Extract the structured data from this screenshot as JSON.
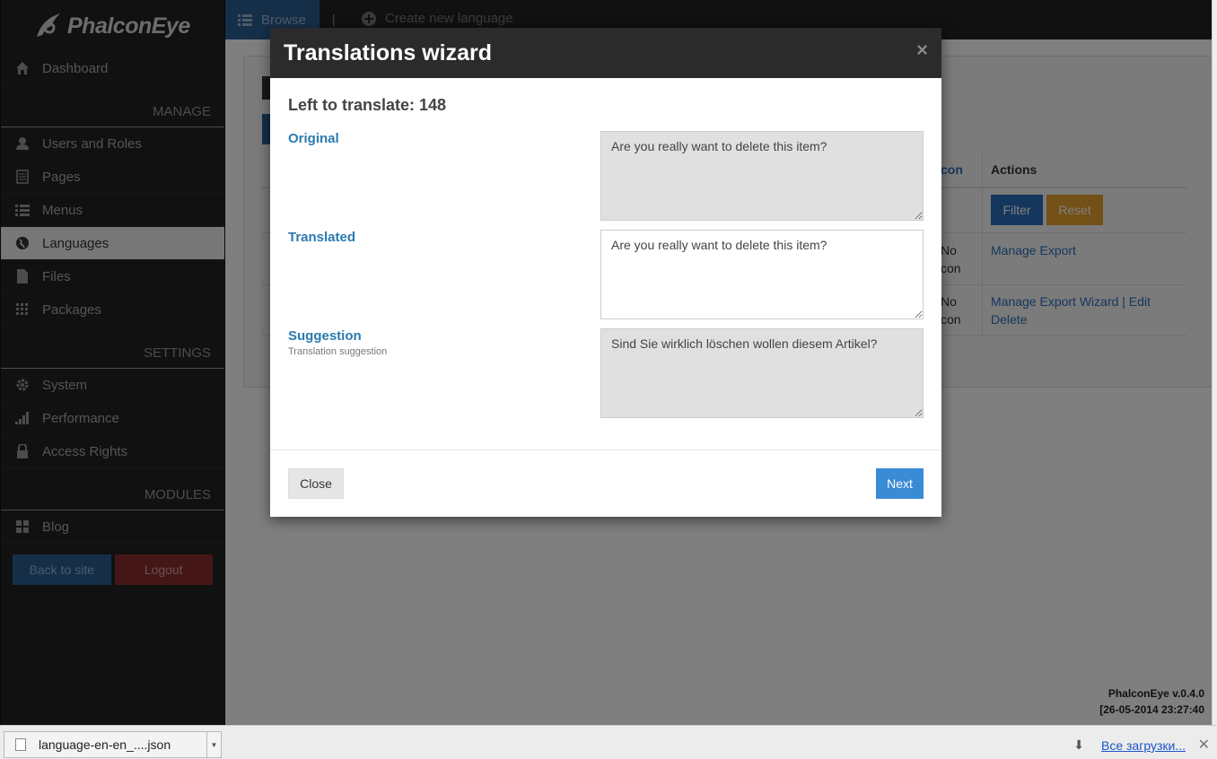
{
  "sidebar": {
    "logo_text": "PhalconEye",
    "dashboard": "Dashboard",
    "manage_header": "MANAGE",
    "manage_items": [
      {
        "label": "Users and Roles",
        "icon": "user-icon"
      },
      {
        "label": "Pages",
        "icon": "pages-icon"
      },
      {
        "label": "Menus",
        "icon": "menu-list-icon"
      },
      {
        "label": "Languages",
        "icon": "globe-icon",
        "active": true
      },
      {
        "label": "Files",
        "icon": "file-icon"
      },
      {
        "label": "Packages",
        "icon": "grid-icon"
      }
    ],
    "settings_header": "SETTINGS",
    "settings_items": [
      {
        "label": "System",
        "icon": "gear-icon"
      },
      {
        "label": "Performance",
        "icon": "signal-icon"
      },
      {
        "label": "Access Rights",
        "icon": "lock-icon"
      }
    ],
    "modules_header": "MODULES",
    "modules_items": [
      {
        "label": "Blog",
        "icon": "grid-icon"
      }
    ],
    "back_to_site": "Back to site",
    "logout": "Logout"
  },
  "topbar": {
    "browse": "Browse",
    "separator": "|",
    "create_new_language": "Create new language"
  },
  "background": {
    "col_icon_partial": "con",
    "col_actions": "Actions",
    "filter": "Filter",
    "reset": "Reset",
    "row1_no": "No",
    "row1_icon": "con",
    "row1_actions": "Manage Export",
    "row2_no": "No",
    "row2_icon": "con",
    "row2_actions_line1": "Manage Export Wizard | Edit",
    "row2_actions_line2": "Delete",
    "version": "PhalconEye v.0.4.0",
    "timestamp": "[26-05-2014 23:27:40"
  },
  "modal": {
    "title": "Translations wizard",
    "close_symbol": "×",
    "left_to_translate": "Left to translate: 148",
    "original_label": "Original",
    "original_value": "Are you really want to delete this item?",
    "translated_label": "Translated",
    "translated_value": "Are you really want to delete this item?",
    "suggestion_label": "Suggestion",
    "suggestion_sub": "Translation suggestion",
    "suggestion_value": "Sind Sie wirklich löschen wollen diesem Artikel?",
    "close_button": "Close",
    "next_button": "Next"
  },
  "download_bar": {
    "file_name": "language-en-en_....json",
    "all_downloads": "Все загрузки...",
    "close_symbol": "✕"
  },
  "colors": {
    "sidebar_bg": "#222222",
    "primary": "#3a8bd6",
    "danger": "#8a2c2c",
    "label_blue": "#2a7ab0"
  }
}
